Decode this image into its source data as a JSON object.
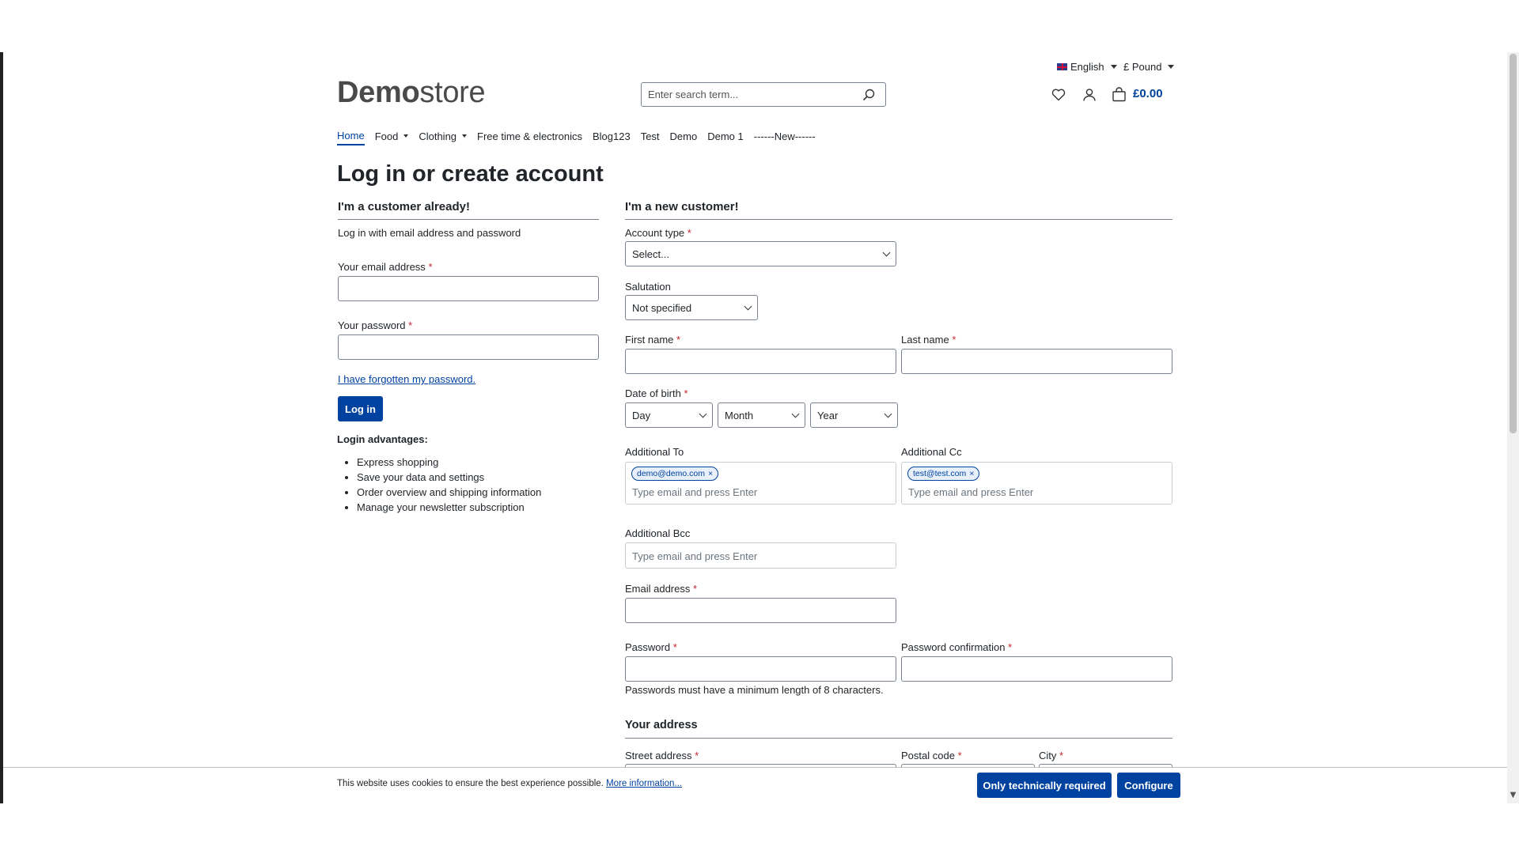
{
  "header": {
    "language": "English",
    "currency": "£ Pound",
    "logo_bold": "Demo",
    "logo_light": "store",
    "search_placeholder": "Enter search term...",
    "cart_total": "£0.00"
  },
  "nav": {
    "items": [
      {
        "label": "Home"
      },
      {
        "label": "Food"
      },
      {
        "label": "Clothing"
      },
      {
        "label": "Free time & electronics"
      },
      {
        "label": "Blog123"
      },
      {
        "label": "Test"
      },
      {
        "label": "Demo"
      },
      {
        "label": "Demo 1"
      },
      {
        "label": "------New------"
      }
    ]
  },
  "page": {
    "title": "Log in or create account"
  },
  "login": {
    "title": "I'm a customer already!",
    "subtitle": "Log in with email address and password",
    "email_label": "Your email address",
    "password_label": "Your password",
    "required_mark": "*",
    "forgot_link": "I have forgotten my password.",
    "login_button": "Log in",
    "advantages_title": "Login advantages:",
    "advantages": [
      "Express shopping",
      "Save your data and settings",
      "Order overview and shipping information",
      "Manage your newsletter subscription"
    ]
  },
  "register": {
    "title": "I'm a new customer!",
    "account_type_label": "Account type",
    "account_type_value": "Select...",
    "salutation_label": "Salutation",
    "salutation_value": "Not specified",
    "first_name_label": "First name",
    "last_name_label": "Last name",
    "dob_label": "Date of birth",
    "dob_day": "Day",
    "dob_month": "Month",
    "dob_year": "Year",
    "additional_to_label": "Additional To",
    "additional_to_tag": "demo@demo.com",
    "additional_cc_label": "Additional Cc",
    "additional_cc_tag": "test@test.com",
    "additional_bcc_label": "Additional Bcc",
    "tag_placeholder": "Type email and press Enter",
    "tag_remove": "×",
    "email_label": "Email address",
    "password_label": "Password",
    "password_confirm_label": "Password confirmation",
    "password_hint": "Passwords must have a minimum length of 8 characters.",
    "address_title": "Your address",
    "street_label": "Street address",
    "postal_label": "Postal code",
    "city_label": "City"
  },
  "cookie": {
    "text": "This website uses cookies to ensure the best experience possible.",
    "link": "More information...",
    "btn_required": "Only technically required",
    "btn_configure": "Configure"
  },
  "colors": {
    "primary": "#0042a0",
    "required": "#c5252d",
    "border": "#798490"
  }
}
